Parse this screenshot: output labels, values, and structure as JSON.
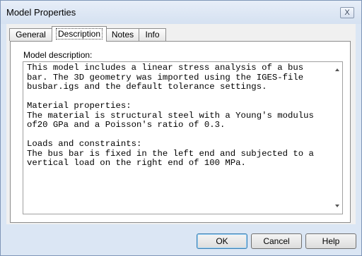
{
  "window": {
    "title": "Model Properties",
    "close_label": "X"
  },
  "tabs": [
    {
      "label": "General",
      "active": false
    },
    {
      "label": "Description",
      "active": true
    },
    {
      "label": "Notes",
      "active": false
    },
    {
      "label": "Info",
      "active": false
    }
  ],
  "description": {
    "label": "Model description:",
    "text": "This model includes a linear stress analysis of a bus\nbar. The 3D geometry was imported using the IGES-file\nbusbar.igs and the default tolerance settings.\n\nMaterial properties:\nThe material is structural steel with a Young's modulus\nof20 GPa and a Poisson's ratio of 0.3.\n\nLoads and constraints:\nThe bus bar is fixed in the left end and subjected to a\nvertical load on the right end of 100 MPa."
  },
  "buttons": {
    "ok": "OK",
    "cancel": "Cancel",
    "help": "Help"
  }
}
